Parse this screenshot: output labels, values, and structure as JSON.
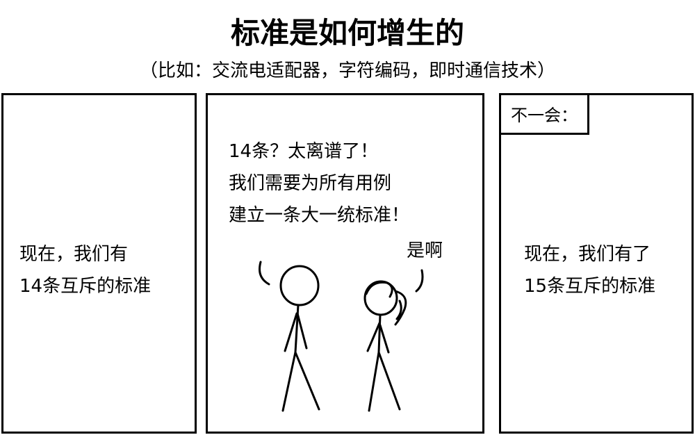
{
  "title": "标准是如何增生的",
  "subtitle": "（比如：交流电适配器，字符编码，即时通信技术）",
  "panel1": {
    "lines": [
      "现在，我们有",
      "14条互斥的标准"
    ]
  },
  "panel2": {
    "speech": [
      "14条？太离谱了！",
      "我们需要为所有用例",
      "建立一条大一统标准！"
    ],
    "reply": "是啊"
  },
  "panel3": {
    "caption": "不一会：",
    "lines": [
      "现在，我们有了",
      "15条互斥的标准"
    ]
  }
}
